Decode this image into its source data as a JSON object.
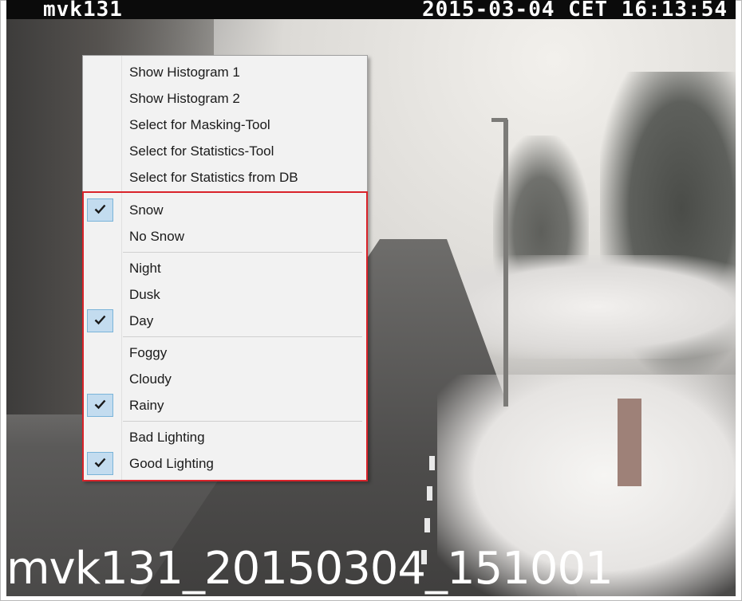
{
  "overlay": {
    "camera_id": "mvk131",
    "datetime": "2015-03-04 CET 16:13:54",
    "filename": "mvk131_20150304_151001"
  },
  "menu": {
    "actions": [
      {
        "label": "Show Histogram 1"
      },
      {
        "label": "Show Histogram 2"
      },
      {
        "label": "Select for Masking-Tool"
      },
      {
        "label": "Select for Statistics-Tool"
      },
      {
        "label": "Select for Statistics from DB"
      }
    ],
    "groups": [
      [
        {
          "label": "Snow",
          "checked": true
        },
        {
          "label": "No Snow",
          "checked": false
        }
      ],
      [
        {
          "label": "Night",
          "checked": false
        },
        {
          "label": "Dusk",
          "checked": false
        },
        {
          "label": "Day",
          "checked": true
        }
      ],
      [
        {
          "label": "Foggy",
          "checked": false
        },
        {
          "label": "Cloudy",
          "checked": false
        },
        {
          "label": "Rainy",
          "checked": true
        }
      ],
      [
        {
          "label": "Bad Lighting",
          "checked": false
        },
        {
          "label": "Good Lighting",
          "checked": true
        }
      ]
    ]
  },
  "colors": {
    "highlight_border": "#d9232a",
    "check_background": "#c3dcef",
    "menu_background": "#f2f2f2"
  }
}
